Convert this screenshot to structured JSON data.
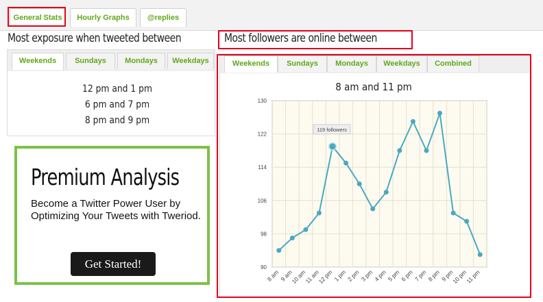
{
  "top_tabs": [
    {
      "label": "General Stats"
    },
    {
      "label": "Hourly Graphs"
    },
    {
      "label": "@replies"
    }
  ],
  "left": {
    "heading": "Most exposure when tweeted between",
    "subtabs": [
      {
        "label": "Weekends"
      },
      {
        "label": "Sundays"
      },
      {
        "label": "Mondays"
      },
      {
        "label": "Weekdays"
      }
    ],
    "times": [
      "12 pm and 1 pm",
      "6 pm and 7 pm",
      "8 pm and 9 pm"
    ]
  },
  "right": {
    "heading": "Most followers are online between",
    "subtabs": [
      {
        "label": "Weekends"
      },
      {
        "label": "Sundays"
      },
      {
        "label": "Mondays"
      },
      {
        "label": "Weekdays"
      },
      {
        "label": "Combined"
      }
    ],
    "chart_title": "8 am and 11 pm"
  },
  "promo": {
    "title": "Premium Analysis",
    "body": "Become a Twitter Power User by Optimizing Your Tweets with Tweriod.",
    "button": "Get Started!"
  },
  "colors": {
    "accent_green": "#5fa81a",
    "highlight_red": "#e2001a",
    "line": "#4aa8c0",
    "promo_border": "#7cc245"
  },
  "chart_data": {
    "type": "line",
    "categories": [
      "8 am",
      "9 am",
      "10 am",
      "11 am",
      "12 pm",
      "1 pm",
      "2 pm",
      "3 pm",
      "4 pm",
      "5 pm",
      "6 pm",
      "7 pm",
      "8 pm",
      "9 pm",
      "10 pm",
      "11 pm"
    ],
    "values": [
      94,
      97,
      99,
      103,
      119,
      115,
      110,
      104,
      108,
      118,
      125,
      118,
      127,
      103,
      101,
      93
    ],
    "ylim": [
      90,
      130
    ],
    "yticks": [
      90,
      98,
      106,
      114,
      122,
      130
    ],
    "tooltip": "119 followers",
    "tooltip_index": 4,
    "grid": true
  }
}
